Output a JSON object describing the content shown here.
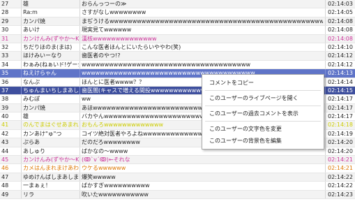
{
  "colors": {
    "pink": "#cc3399",
    "orange": "#dd7700",
    "yellow": "#cccc00",
    "red": "#dd3322",
    "maroon": "#993333"
  },
  "comments": [
    {
      "no": "27",
      "user": "雄",
      "comment": "おらんっつーの≫",
      "time": "02:14:03",
      "style": "alt"
    },
    {
      "no": "28",
      "user": "Ra:m",
      "comment": "さすがなしwwwwwwww",
      "time": "02:14:05",
      "style": ""
    },
    {
      "no": "29",
      "user": "カンパ焼",
      "comment": "まぢうけるwwwwwwwwwwwwwwwwwwwwwwwwwwwwwwwwwwwwwwwwwwwwwwwwwwwww",
      "time": "02:14:08",
      "style": "alt"
    },
    {
      "no": "30",
      "user": "あいけ",
      "comment": "現実見てwwwwww",
      "time": "02:14:08",
      "style": ""
    },
    {
      "no": "31",
      "user": "カンけんみ(ずやか～Kc",
      "comment": "漢核wwwwwwwwwwwwww",
      "time": "02:14:08",
      "style": "alt",
      "color": "pink"
    },
    {
      "no": "32",
      "user": "ちだりほのま(まは)",
      "comment": "こんな医者ほんとにいたらいややわ(笑)",
      "time": "02:14:10",
      "style": ""
    },
    {
      "no": "33",
      "user": "ほけみいーなり",
      "comment": "歯医者のやつ!?",
      "time": "02:14:12",
      "style": "alt"
    },
    {
      "no": "34",
      "user": "わぁみ(ねぁいド!ゲーシル",
      "comment": "wwwwwwwwwwwwwwwwwwwwwwwwwwwwwwwwwwwww",
      "time": "02:14:12",
      "style": ""
    },
    {
      "no": "35",
      "user": "ねえけらゃん",
      "comment": "wwwwwwwwwwwwwwwwwwwwwwwwwwwwwwwwwwwwww",
      "time": "02:14:13",
      "style": "sel1"
    },
    {
      "no": "36",
      "user": "なんぷ",
      "comment": "ほんとに医者wwww？？",
      "time": "02:14:14",
      "style": ""
    },
    {
      "no": "37",
      "user": "ちゅんまいちしまあしま",
      "comment": "歯医闇(キャスで増える間投wwwwwwwwwwwwwwwwwwwwwwwwwwwwwwwwwww",
      "time": "02:14:15",
      "style": "sel2"
    },
    {
      "no": "38",
      "user": "みむぽ",
      "comment": "ww",
      "time": "02:14:17",
      "style": ""
    },
    {
      "no": "39",
      "user": "カンパ焼",
      "comment": "あほwwwwwwwwwwwwwwwwwwwwwwwwwwwwwwwwwwwwwwwwwwwwwwwwwwwwwwwwwwww",
      "time": "02:14:17",
      "style": "alt"
    },
    {
      "no": "40",
      "user": "雄",
      "comment": "バカやんwwwwwwwwwwwwwwwwwwwwwwwwwwwwwwwwwwwwwwwwwwwwww",
      "time": "02:14:17",
      "style": ""
    },
    {
      "no": "41",
      "user": "のんでまはぐせあまれほし",
      "comment": "おもんろwwwwwwwwwwwww",
      "time": "02:14:18",
      "style": "alt",
      "color": "yellow"
    },
    {
      "no": "42",
      "user": "カンあけ\"ゅ\"つ",
      "comment": "コイツ絶対医者やろよねwwwwwwwwwwwwwwwwwwwwwwwwwwwwwwwwwwwww",
      "time": "02:14:19",
      "style": ""
    },
    {
      "no": "43",
      "user": "ぷらあ",
      "comment": "だのだろwwwwwwww",
      "time": "02:14:20",
      "style": "alt"
    },
    {
      "no": "44",
      "user": "あしゅり",
      "comment": "ばかなの～wwww",
      "time": "02:14:20",
      "style": ""
    },
    {
      "no": "45",
      "user": "カンけんみ(ずやか～Kc",
      "comment": "(ↂ`ⅴ´ↂ)←それな",
      "time": "02:14:21",
      "style": "alt",
      "color": "pink"
    },
    {
      "no": "46",
      "user": "カメはんまれまけあわる",
      "comment": "ウケるwwwwww",
      "time": "02:14:21",
      "style": "",
      "color": "orange"
    },
    {
      "no": "47",
      "user": "ゆめけんばしまあしま",
      "comment": "爆笑wwwww",
      "time": "02:14:22",
      "style": "alt"
    },
    {
      "no": "48",
      "user": "一まぁぇ！",
      "comment": "ばかすぎwwwwwwwwww",
      "time": "02:14:22",
      "style": ""
    },
    {
      "no": "49",
      "user": "リラ",
      "comment": "吹いたwwwwwwwwwww",
      "time": "02:14:23",
      "style": "alt"
    }
  ],
  "context_menu": {
    "items": [
      "コメントをコピー",
      "このユーザーのライブページを開く",
      "このユーザーの過去コメントを表示",
      "このユーザーの文字色を変更",
      "このユーザーの背景色を編集"
    ]
  }
}
